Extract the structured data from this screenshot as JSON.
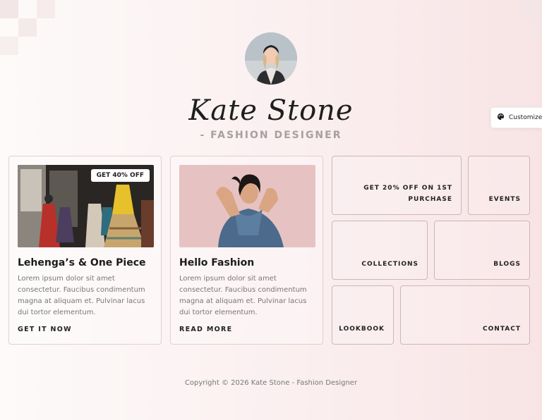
{
  "profile": {
    "name": "Kate Stone",
    "role": "- FASHION DESIGNER"
  },
  "customize": {
    "label": "Customize"
  },
  "cards": [
    {
      "badge": "GET 40% OFF",
      "title": "Lehenga’s & One Piece",
      "body": "Lorem ipsum dolor sit amet consectetur. Faucibus condimentum magna at aliquam et. Pulvinar lacus dui tortor elementum.",
      "cta": "GET IT NOW"
    },
    {
      "title": "Hello Fashion",
      "body": "Lorem ipsum dolor sit amet consectetur. Faucibus condimentum magna at aliquam et. Pulvinar lacus dui tortor elementum.",
      "cta": "READ MORE"
    }
  ],
  "tiles": {
    "offer": "GET 20% OFF ON 1ST PURCHASE",
    "events": "EVENTS",
    "collections": "COLLECTIONS",
    "blogs": "BLOGS",
    "lookbook": "LOOKBOOK",
    "contact": "CONTACT"
  },
  "footer": {
    "copyright": "Copyright © 2026 Kate Stone - Fashion Designer"
  },
  "colors": {
    "background": "#fbeff0",
    "border": "#c9b8b9",
    "text": "#1b1b1b",
    "muted": "#777777"
  }
}
